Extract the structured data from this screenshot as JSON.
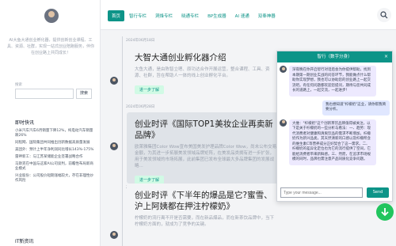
{
  "sidebar": {
    "description": "AI大鱼大通创业孵化器，提供创新创业课程、工具、资源、社群，实现一站式创业陪跑服务，伴你在创业路上共同成长！",
    "search_placeholder": "搜索",
    "search_button": "搜索",
    "news_title": "即时快讯",
    "news": [
      "小米汽车汽车6月销量下降12%，纯电动汽车销量跌26%",
      "同程网、国际集团共同推出创新数据高质量发展",
      "美团外：预计上半年净利润同比增长143%-175%",
      "雷神新工：与江苏某储能企业签署战略合作",
      "马斯克在中国与这家AI公司谈判，前瞻性布局新商业模式",
      "兴业股份：公司股价短期涨幅较大，存在非理性炒作风险"
    ],
    "hot_title": "IT新资讯"
  },
  "nav": {
    "tabs": [
      "首页",
      "智行专栏",
      "洞烽专栏",
      "晓通专栏",
      "BP生成器",
      "AI 速通",
      "双奉神器"
    ]
  },
  "posts": [
    {
      "date": "2024年06月18日",
      "title": "大智大通创业孵化器介绍",
      "body": "大鱼大通，是由陈智立嗯、原功达合作开展运营，整合课程、工具、资源、社群，旨在帮助人一体的线上创业孵化平台。",
      "readmore": "进一步了解"
    },
    {
      "date": "2024年06月28日",
      "title": "创业时评《国际TOP1美妆企业再卖新品牌》",
      "body": "欧莱雅集团Color Wow宣布美国美发护理品牌Color Wow，尚未公布交易金额，为其进一步拓展美发领域品牌矩阵，在美发品类拥有进一步扩张，用于美发领域的市场拓展，此前集团已发布全球最大多品牌集团的发展战略...",
      "readmore": "进一步了解"
    },
    {
      "date": "2024年07月03日",
      "title": "创业时评《下半年的爆品是它?蜜雪、沪上阿姨都在押注柠檬奶》",
      "body": "柠檬奶的流行离不开是否需要，而在新品爆品，而在新茶饮品牌中，当下柠檬奶方面的，就成为了竞争的关键。",
      "readmore": "进一步了解"
    }
  ],
  "chat": {
    "title": "智行（数字分身）",
    "close": "×",
    "messages": [
      {
        "role": "bot",
        "text": "深夜晚在你开启智行对话后会为你提供帮助，找到本期第一期创业实战的问答环节，我能做点什么帮助你实现梦想，我也可以协助您的创业路上一起交流吧。有任何问题都欢迎您提问，期待与您共同成长的道路上，一起交流，一起进步！"
      },
      {
        "role": "user",
        "text": "我也想知道\"柠檬奶\"这业，请你帮我简要分析。"
      },
      {
        "role": "bot",
        "text": "大维：\"柠檬奶\"这个创新茶饮品牌值得被关注，以下是关于柠檬奶的一些分析与看法：一、趋势：现代消费者对健康和清爽饮品的需求不断增加，柠檬奶作为新兴品类，其天然清新的口感以及柠檬所含的维生素C等营养成分正好契合了这一需求。二、柠檬奶的差异化定位也为它的流行提供了空间，它能给消费者带来新鲜感。三、然而，在追求市场规模的同时，品牌也需注意产品同质化竞争问题。"
      }
    ],
    "input_placeholder": "Type your message...",
    "send": "Send"
  }
}
